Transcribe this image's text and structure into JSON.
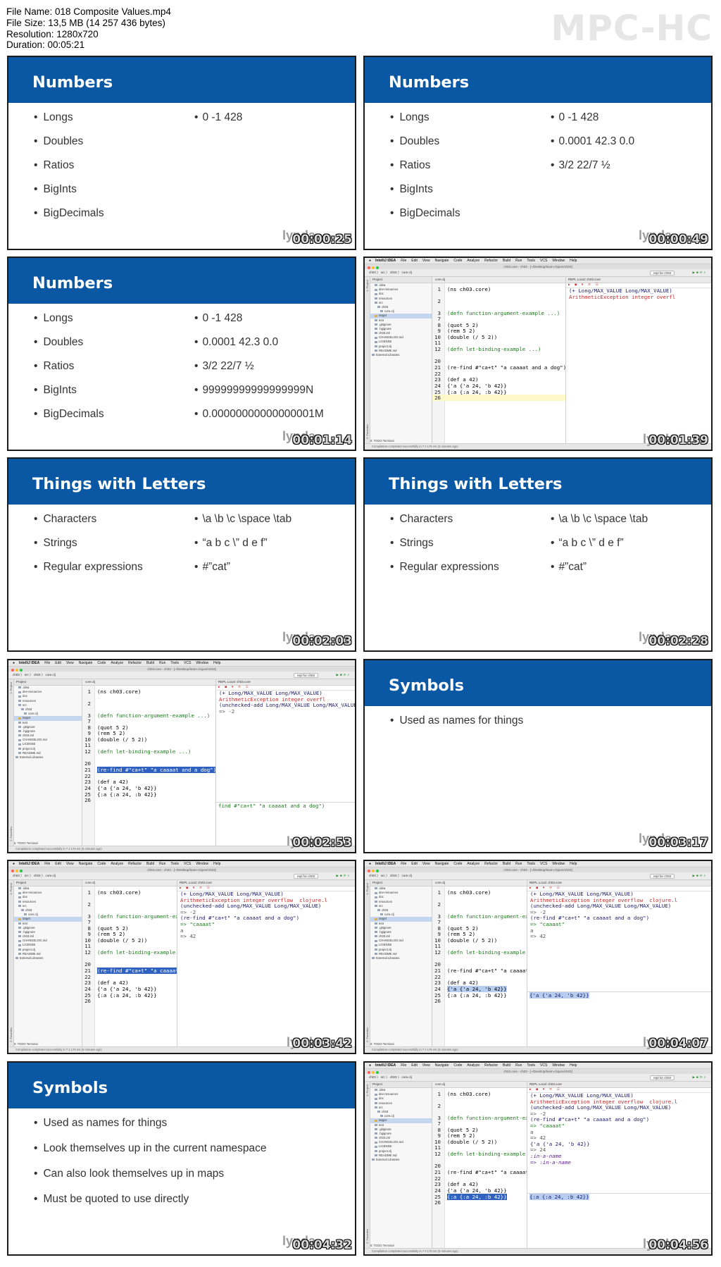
{
  "file_info": {
    "name": "File Name: 018 Composite Values.mp4",
    "size": "File Size: 13,5 MB (14 257 436 bytes)",
    "resolution": "Resolution: 1280x720",
    "duration": "Duration: 00:05:21"
  },
  "logo": "MPC-HC",
  "watermark": "lynda",
  "timestamps": [
    "00:00:25",
    "00:00:49",
    "00:01:14",
    "00:01:39",
    "00:02:03",
    "00:02:28",
    "00:02:53",
    "00:03:17",
    "00:03:42",
    "00:04:07",
    "00:04:32",
    "00:04:56"
  ],
  "slides": {
    "numbers": {
      "title": "Numbers",
      "bullets": [
        "Longs",
        "Doubles",
        "Ratios",
        "BigInts",
        "BigDecimals"
      ],
      "values_1": [
        "0 -1 428"
      ],
      "values_2": [
        "0 -1 428",
        "0.0001 42.3 0.0",
        "3/2 22/7 ½"
      ],
      "values_3": [
        "0 -1 428",
        "0.0001 42.3 0.0",
        "3/2 22/7 ½",
        "99999999999999999N",
        "0.00000000000000001M"
      ]
    },
    "letters": {
      "title": "Things with Letters",
      "bullets": [
        "Characters",
        "Strings",
        "Regular expressions"
      ],
      "values": [
        "\\a \\b \\c \\space \\tab",
        "“a b c \\” d e f”",
        "#”cat”"
      ]
    },
    "symbols": {
      "title": "Symbols",
      "bullets_1": [
        "Used as names for things"
      ],
      "bullets_2": [
        "Used as names for things",
        "Look themselves up in the current namespace",
        "Can also look themselves up in maps",
        "Must be quoted to use directly"
      ]
    }
  },
  "ide": {
    "menu": [
      "IntelliJ IDEA",
      "File",
      "Edit",
      "View",
      "Navigate",
      "Code",
      "Analyze",
      "Refactor",
      "Build",
      "Run",
      "Tools",
      "VCS",
      "Window",
      "Help"
    ],
    "window_title": "ch03.core - ch03 - [~/Desktop/learn-clojure/ch03]",
    "breadcrumb": "ch03 〉 src 〉 ch03 〉 core.clj",
    "run_config": "repl for ch03",
    "project_label": "Project",
    "tree": [
      ".idea",
      "dev-resources",
      "doc",
      "resources",
      "src",
      "ch03",
      "core.clj",
      "target",
      "test",
      ".gitignore",
      ".hgignore",
      "ch03.iml",
      "CHANGELOG.md",
      "LICENSE",
      "project.clj",
      "README.md",
      "External Libraries"
    ],
    "editor_tab": "core.clj",
    "code": [
      {
        "n": "1",
        "t": "(ns ch03.core)"
      },
      {
        "n": "2",
        "t": ""
      },
      {
        "n": "3",
        "t": "(defn function-argument-example ...)"
      },
      {
        "n": "7",
        "t": ""
      },
      {
        "n": "8",
        "t": "(quot 5 2)"
      },
      {
        "n": "9",
        "t": "(rem 5 2)"
      },
      {
        "n": "10",
        "t": "(double (/ 5 2))"
      },
      {
        "n": "11",
        "t": ""
      },
      {
        "n": "12",
        "t": "(defn let-binding-example ...)"
      },
      {
        "n": "20",
        "t": ""
      },
      {
        "n": "21",
        "t": "(re-find #\"ca+t\" \"a caaaat and a dog\")"
      },
      {
        "n": "22",
        "t": ""
      },
      {
        "n": "23",
        "t": "(def a 42)"
      },
      {
        "n": "24",
        "t": "{'a {'a 24, 'b 42}}"
      },
      {
        "n": "25",
        "t": "{:a {:a 24, :b 42}}"
      },
      {
        "n": "26",
        "t": ""
      }
    ],
    "repl_title": "REPL Local: ch03.core",
    "repl_out": {
      "l1": "(+ Long/MAX_VALUE Long/MAX_VALUE)",
      "l2": "ArithmeticException integer overfl",
      "l2b": "ArithmeticException integer overflow  clojure.l",
      "l3": "(unchecked-add Long/MAX_VALUE Long/MAX_VALUE",
      "l3b": "(unchecked-add Long/MAX_VALUE Long/MAX_VALUE)",
      "l4": "=> -2",
      "l5": "(re-find #\"ca+t\" \"a caaaat and a dog\")",
      "l6": "=> \"caaaat\"",
      "l7": "a",
      "l8": "=> 42",
      "l9": "{'a {'a 24, 'b 42}}",
      "l10": "=> 24",
      "l11": ":in-a-name",
      "l12": "=> :in-a-name"
    },
    "repl_input_1": "find #\"ca+t\" \"a caaaat and a dog\")",
    "repl_input_2": "{'a {'a 24, 'b 42}}",
    "repl_input_3": "{:a {:a 24, :b 42}}",
    "bottom_tabs": "6: TODO     Terminal",
    "status": "Compilation completed successfully in 7 s 178 ms (5 minutes ago)",
    "status_right": "24:1  LF  UTF-8  Git: master"
  },
  "colors": {
    "slide_title_bg": "#0a57a3",
    "slide_text": "#333333",
    "selection": "#2f62c0",
    "repl_error": "#c82828",
    "string_green": "#1b7a1b"
  }
}
